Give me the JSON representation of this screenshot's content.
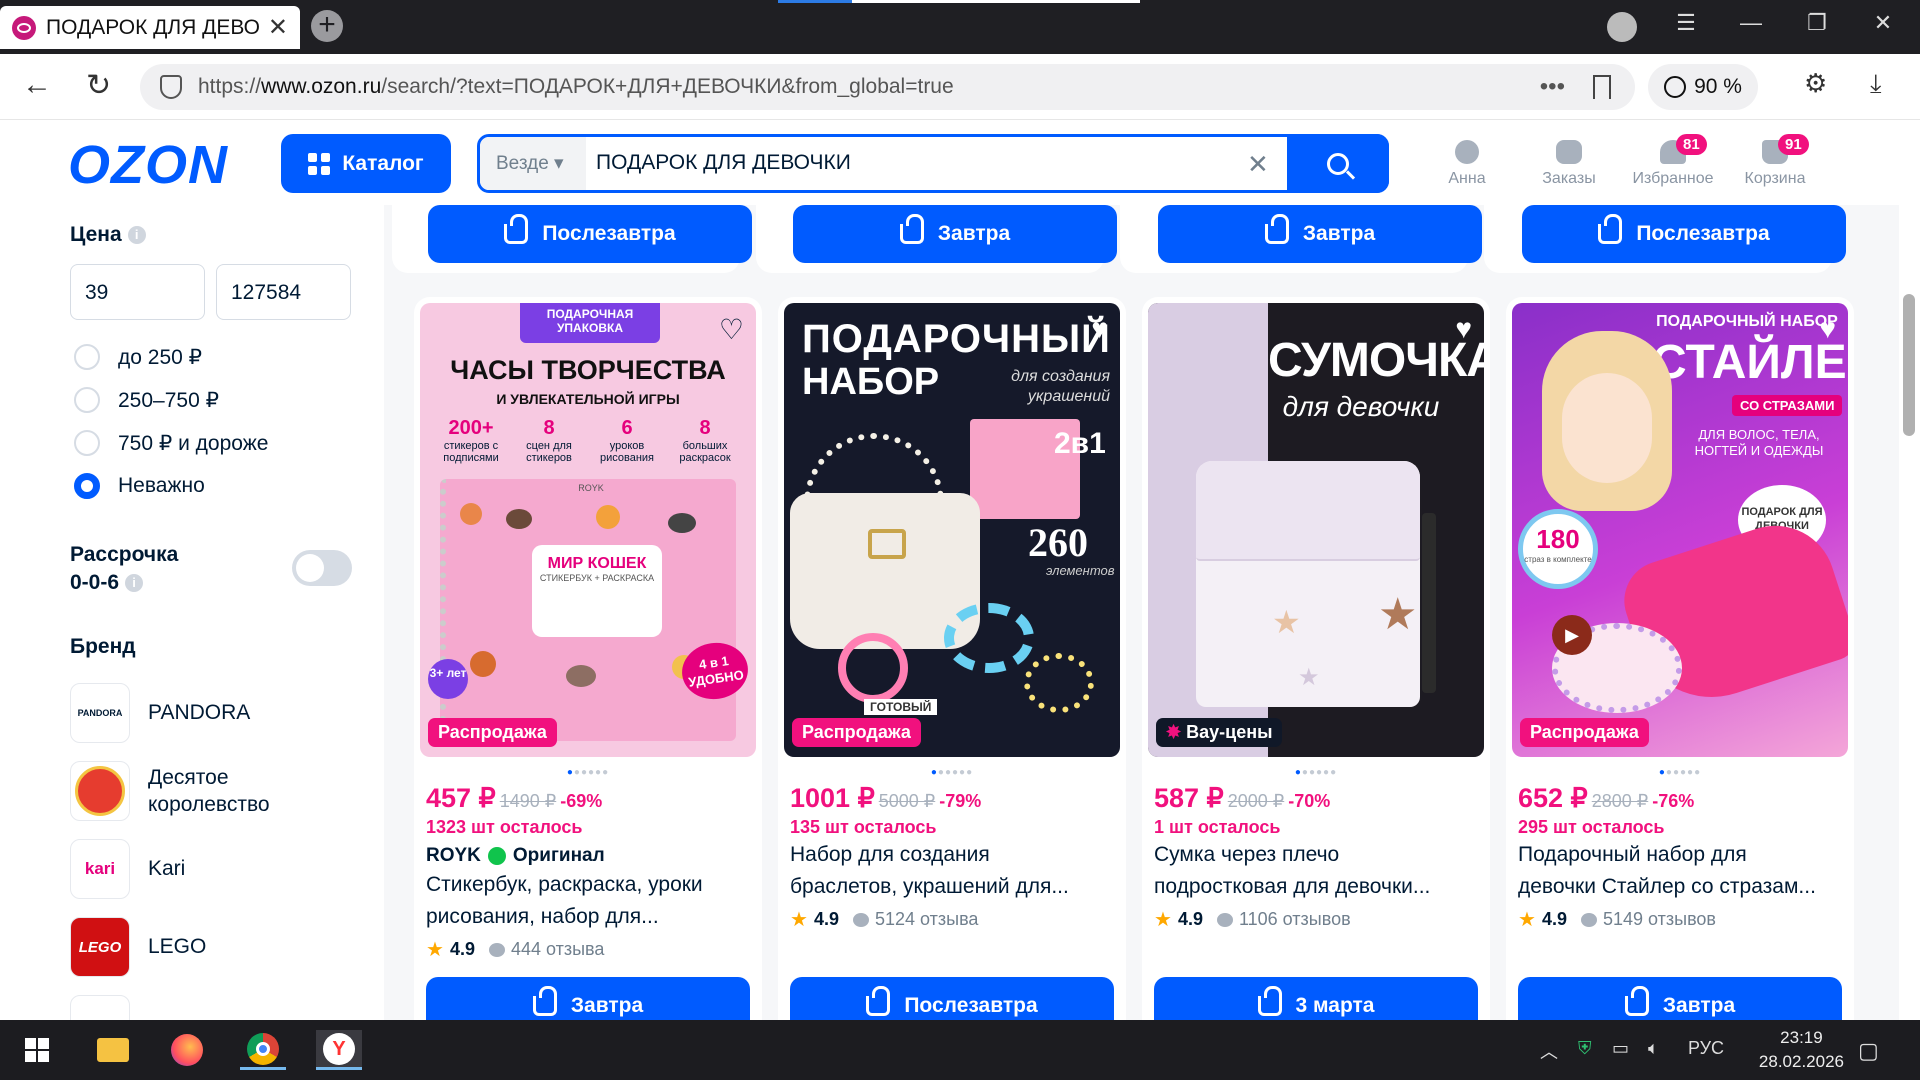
{
  "browser": {
    "tab_title": "ПОДАРОК ДЛЯ ДЕВОЧ",
    "url_prefix": "https://",
    "url_domain": "www.ozon.ru",
    "url_path": "/search/?text=ПОДАРОК+ДЛЯ+ДЕВОЧКИ&from_global=true",
    "zoom": "90 %"
  },
  "header": {
    "logo": "OZON",
    "catalog_label": "Каталог",
    "search_scope": "Везде",
    "search_query": "ПОДАРОК ДЛЯ ДЕВОЧКИ",
    "user_label": "Анна",
    "orders_label": "Заказы",
    "favorites_label": "Избранное",
    "favorites_count": "81",
    "cart_label": "Корзина",
    "cart_count": "91"
  },
  "filters": {
    "price_title": "Цена",
    "price_from": "39",
    "price_to": "127584",
    "price_options": [
      "до 250 ₽",
      "250–750 ₽",
      "750 ₽ и дороже",
      "Неважно"
    ],
    "installment_line1": "Рассрочка",
    "installment_line2": "0-0-6",
    "brand_title": "Бренд",
    "brands": [
      {
        "name": "PANDORA",
        "logo_text": "PANDORA"
      },
      {
        "name_line1": "Десятое",
        "name_line2": "королевство"
      },
      {
        "name": "Kari",
        "logo_text": "kari"
      },
      {
        "name": "LEGO",
        "logo_text": "LEGO"
      }
    ]
  },
  "top_row_buttons": [
    "Послезавтра",
    "Завтра",
    "Завтра",
    "Послезавтра"
  ],
  "products": [
    {
      "badge": "Распродажа",
      "price": "457 ₽",
      "old_price": "1490 ₽",
      "discount": "-69%",
      "stock": "1323 шт осталось",
      "seller": "ROYK",
      "seller_tag": "Оригинал",
      "title_line1": "Стикербук, раскраска, уроки",
      "title_line2": "рисования, набор для...",
      "rating": "4.9",
      "reviews": "444 отзыва",
      "delivery": "Завтра",
      "img_caption_top": "ПОДАРОЧНАЯ УПАКОВКА",
      "img_heading": "ЧАСЫ ТВОРЧЕСТВА",
      "img_subheading": "И УВЛЕКАТЕЛЬНОЙ ИГРЫ",
      "img_stat_values": [
        "200+",
        "8",
        "6",
        "8"
      ],
      "img_stat_labels": [
        "стикеров с подписями",
        "сцен для стикеров",
        "уроков рисования",
        "больших раскрасок"
      ],
      "img_book_brand": "ROYK",
      "img_book_title": "МИР КОШЕК",
      "img_book_subtitle": "СТИКЕРБУК + РАСКРАСКА",
      "img_age": "3+ лет",
      "img_combo": "4 в 1 УДОБНО"
    },
    {
      "badge": "Распродажа",
      "price": "1001 ₽",
      "old_price": "5000 ₽",
      "discount": "-79%",
      "stock": "135 шт осталось",
      "title_line1": "Набор для создания",
      "title_line2": "браслетов, украшений для...",
      "rating": "4.9",
      "reviews": "5124 отзыва",
      "delivery": "Послезавтра",
      "img_heading1": "ПОДАРОЧНЫЙ",
      "img_heading2": "НАБОР",
      "img_script": "для создания украшений",
      "img_2in1": "2в1",
      "img_count": "260",
      "img_count_label": "элементов",
      "img_ready": "ГОТОВЫЙ"
    },
    {
      "badge": "Вау-цены",
      "price": "587 ₽",
      "old_price": "2000 ₽",
      "discount": "-70%",
      "stock": "1 шт осталось",
      "title_line1": "Сумка через плечо",
      "title_line2": "подростковая для девочки...",
      "rating": "4.9",
      "reviews": "1106 отзывов",
      "delivery": "3 марта",
      "img_heading1": "СУМОЧКА",
      "img_heading2": "для девочки"
    },
    {
      "badge": "Распродажа",
      "price": "652 ₽",
      "old_price": "2800 ₽",
      "discount": "-76%",
      "stock": "295 шт осталось",
      "title_line1": "Подарочный набор для",
      "title_line2": "девочки Стайлер со стразам...",
      "rating": "4.9",
      "reviews": "5149 отзывов",
      "delivery": "Завтра",
      "img_top": "ПОДАРОЧНЫЙ НАБОР",
      "img_heading": "СТАЙЛЕР",
      "img_sub": "СО СТРАЗАМИ",
      "img_desc": "ДЛЯ ВОЛОС, ТЕЛА, НОГТЕЙ И ОДЕЖДЫ",
      "img_gift": "ПОДАРОК ДЛЯ ДЕВОЧКИ",
      "img_count": "180",
      "img_count_label": "страз в комплекте"
    }
  ],
  "taskbar": {
    "lang": "РУС",
    "time": "23:19",
    "date": "28.02.2026"
  }
}
